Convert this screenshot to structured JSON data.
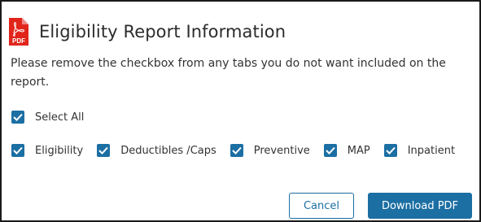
{
  "dialog": {
    "title": "Eligibility Report Information",
    "icon": "pdf-file-icon",
    "icon_label": "PDF",
    "instructions": "Please remove the checkbox from any tabs you do not want included on the report."
  },
  "select_all": {
    "label": "Select All",
    "checked": true
  },
  "tabs": [
    {
      "label": "Eligibility",
      "checked": true
    },
    {
      "label": "Deductibles /Caps",
      "checked": true
    },
    {
      "label": "Preventive",
      "checked": true
    },
    {
      "label": "MAP",
      "checked": true
    },
    {
      "label": "Inpatient",
      "checked": true
    }
  ],
  "buttons": {
    "cancel": "Cancel",
    "download": "Download PDF"
  },
  "colors": {
    "accent": "#1c6fa3",
    "pdf_red": "#e1251b",
    "text": "#333333"
  }
}
